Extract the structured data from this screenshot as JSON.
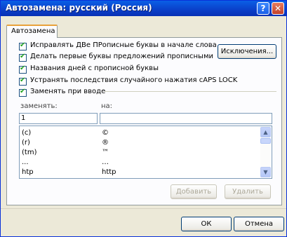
{
  "window": {
    "title": "Автозамена: русский (Россия)"
  },
  "titlebar": {
    "help_label": "?",
    "close_label": "✕"
  },
  "tab": {
    "label": "Автозамена"
  },
  "options": [
    {
      "label": "Исправлять ДВе ПРописные буквы в начале слова",
      "checked": true
    },
    {
      "label": "Делать первые буквы предложений прописными",
      "checked": true
    },
    {
      "label": "Названия дней с прописной буквы",
      "checked": true
    },
    {
      "label": "Устранять последствия случайного нажатия cAPS LOCK",
      "checked": true
    },
    {
      "label": "Заменять при вводе",
      "checked": true
    }
  ],
  "exceptions_button": "Исключения...",
  "replace_label": "заменять:",
  "with_label": "на:",
  "replace_value": "1",
  "with_value": "",
  "entries": [
    {
      "from": "(c)",
      "to": "©"
    },
    {
      "from": "(r)",
      "to": "®"
    },
    {
      "from": "(tm)",
      "to": "™"
    },
    {
      "from": "...",
      "to": "…"
    },
    {
      "from": "htp",
      "to": "http"
    }
  ],
  "add_button": "Добавить",
  "delete_button": "Удалить",
  "ok_button": "ОК",
  "cancel_button": "Отмена"
}
